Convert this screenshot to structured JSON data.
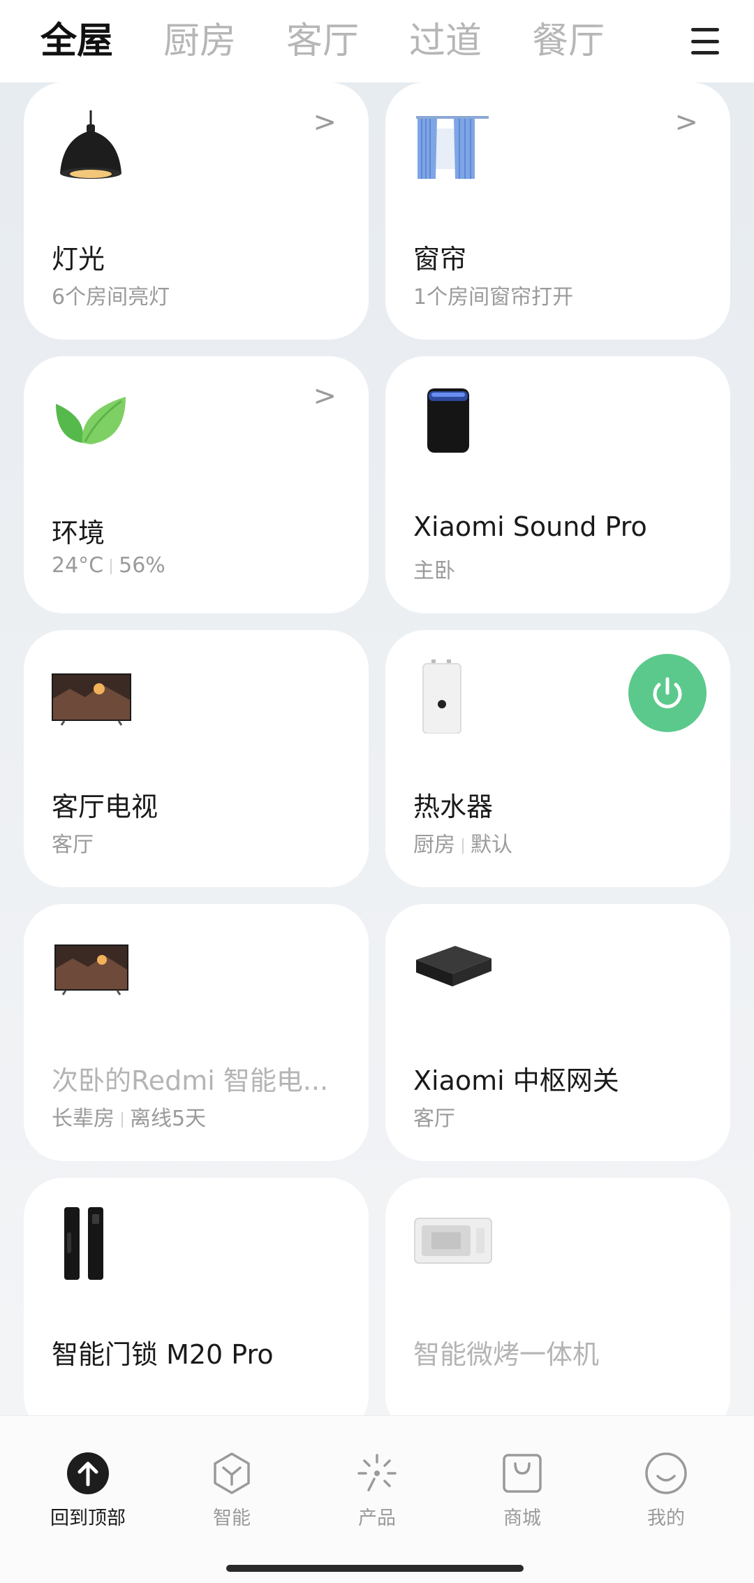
{
  "tabs": [
    {
      "label": "全屋",
      "active": true
    },
    {
      "label": "厨房",
      "active": false
    },
    {
      "label": "客厅",
      "active": false
    },
    {
      "label": "过道",
      "active": false
    },
    {
      "label": "餐厅",
      "active": false
    }
  ],
  "menu_icon": "hamburger-menu-icon",
  "cards": [
    {
      "title": "灯光",
      "sub": [
        "6个房间亮灯"
      ],
      "icon": "pendant-lamp-icon",
      "chevron": ">"
    },
    {
      "title": "窗帘",
      "sub": [
        "1个房间窗帘打开"
      ],
      "icon": "curtain-icon",
      "chevron": ">"
    },
    {
      "title": "环境",
      "sub": [
        "24°C",
        "56%"
      ],
      "icon": "leaf-icon",
      "chevron": ">"
    },
    {
      "title": "Xiaomi Sound Pro",
      "sub": [
        "主卧"
      ],
      "icon": "smart-speaker-icon"
    },
    {
      "title": "客厅电视",
      "sub": [
        "客厅"
      ],
      "icon": "tv-icon"
    },
    {
      "title": "热水器",
      "sub": [
        "厨房",
        "默认"
      ],
      "icon": "water-heater-icon",
      "power": "on"
    },
    {
      "title": "次卧的Redmi 智能电...",
      "sub": [
        "长辈房",
        "离线5天"
      ],
      "icon": "tv-icon",
      "offline": true
    },
    {
      "title": "Xiaomi 中枢网关",
      "sub": [
        "客厅"
      ],
      "icon": "gateway-icon"
    },
    {
      "title": "智能门锁 M20 Pro",
      "sub": [],
      "icon": "door-lock-icon"
    },
    {
      "title": "智能微烤一体机",
      "sub": [],
      "icon": "microwave-icon",
      "offline": true
    }
  ],
  "bottom_nav": [
    {
      "label": "回到顶部",
      "icon": "arrow-up-icon",
      "active": true
    },
    {
      "label": "智能",
      "icon": "hexagon-icon",
      "active": false
    },
    {
      "label": "产品",
      "icon": "sparkle-icon",
      "active": false
    },
    {
      "label": "商城",
      "icon": "shopping-bag-icon",
      "active": false
    },
    {
      "label": "我的",
      "icon": "smiley-icon",
      "active": false
    }
  ],
  "colors": {
    "power_on": "#5bc98c",
    "text_primary": "#1a1a1a",
    "text_secondary": "#9a9a9a"
  }
}
